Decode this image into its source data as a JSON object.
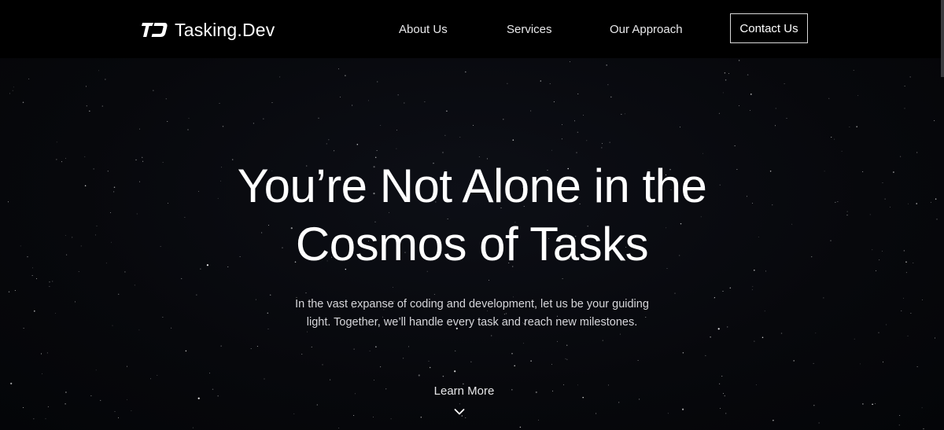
{
  "brand": {
    "name": "Tasking.Dev",
    "logo_icon": "td-monogram-logo"
  },
  "nav": {
    "items": [
      {
        "label": "About Us"
      },
      {
        "label": "Services"
      },
      {
        "label": "Our Approach"
      }
    ],
    "contact_label": "Contact Us"
  },
  "hero": {
    "title_line1": "You’re Not Alone in the",
    "title_line2": "Cosmos of Tasks",
    "subtitle_line1": "In the vast expanse of coding and development, let us be your guiding",
    "subtitle_line2": "light. Together, we’ll handle every task and reach new milestones.",
    "cta_label": "Learn More",
    "cta_icon": "chevron-down-icon"
  },
  "colors": {
    "background": "#07080c",
    "navbar": "#000000",
    "text": "#ffffff",
    "muted_text": "#d6d6da",
    "button_border": "#d8d8d8"
  }
}
